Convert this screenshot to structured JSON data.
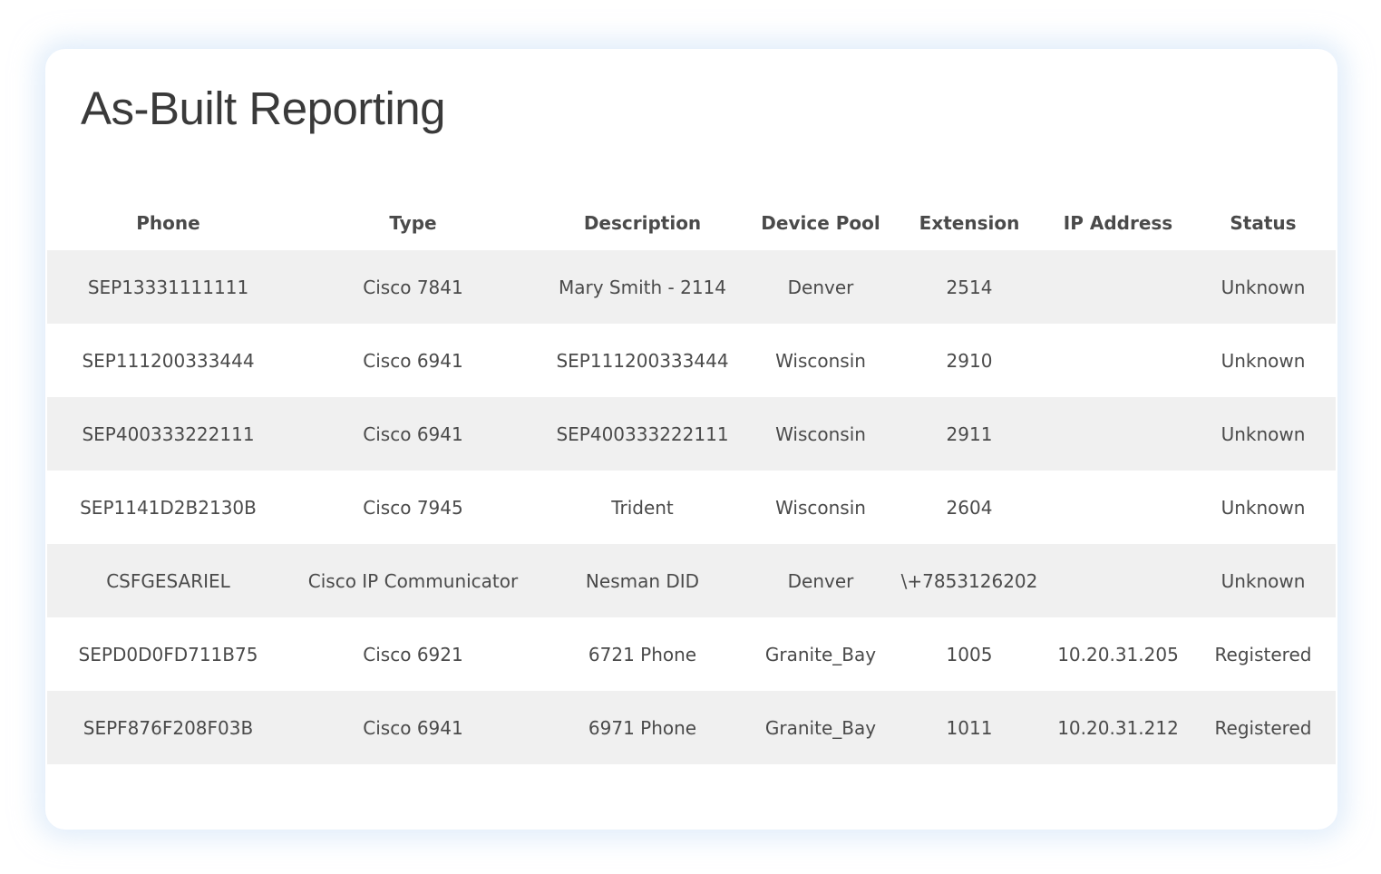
{
  "page": {
    "title": "As-Built Reporting"
  },
  "table": {
    "headers": [
      "Phone",
      "Type",
      "Description",
      "Device Pool",
      "Extension",
      "IP Address",
      "Status"
    ],
    "rows": [
      [
        "SEP13331111111",
        "Cisco 7841",
        "Mary Smith - 2114",
        "Denver",
        "2514",
        "",
        "Unknown"
      ],
      [
        "SEP111200333444",
        "Cisco 6941",
        "SEP111200333444",
        "Wisconsin",
        "2910",
        "",
        "Unknown"
      ],
      [
        "SEP400333222111",
        "Cisco 6941",
        "SEP400333222111",
        "Wisconsin",
        "2911",
        "",
        "Unknown"
      ],
      [
        "SEP1141D2B2130B",
        "Cisco 7945",
        "Trident",
        "Wisconsin",
        "2604",
        "",
        "Unknown"
      ],
      [
        "CSFGESARIEL",
        "Cisco IP Communicator",
        "Nesman DID",
        "Denver",
        "\\+7853126202",
        "",
        "Unknown"
      ],
      [
        "SEPD0D0FD711B75",
        "Cisco 6921",
        "6721 Phone",
        "Granite_Bay",
        "1005",
        "10.20.31.205",
        "Registered"
      ],
      [
        "SEPF876F208F03B",
        "Cisco 6941",
        "6971 Phone",
        "Granite_Bay",
        "1011",
        "10.20.31.212",
        "Registered"
      ]
    ]
  },
  "colors": {
    "row_stripe": "#f0f0f0",
    "text": "#4a4a4a",
    "title": "#3a3a3a",
    "card_glow": "#c8def5"
  }
}
